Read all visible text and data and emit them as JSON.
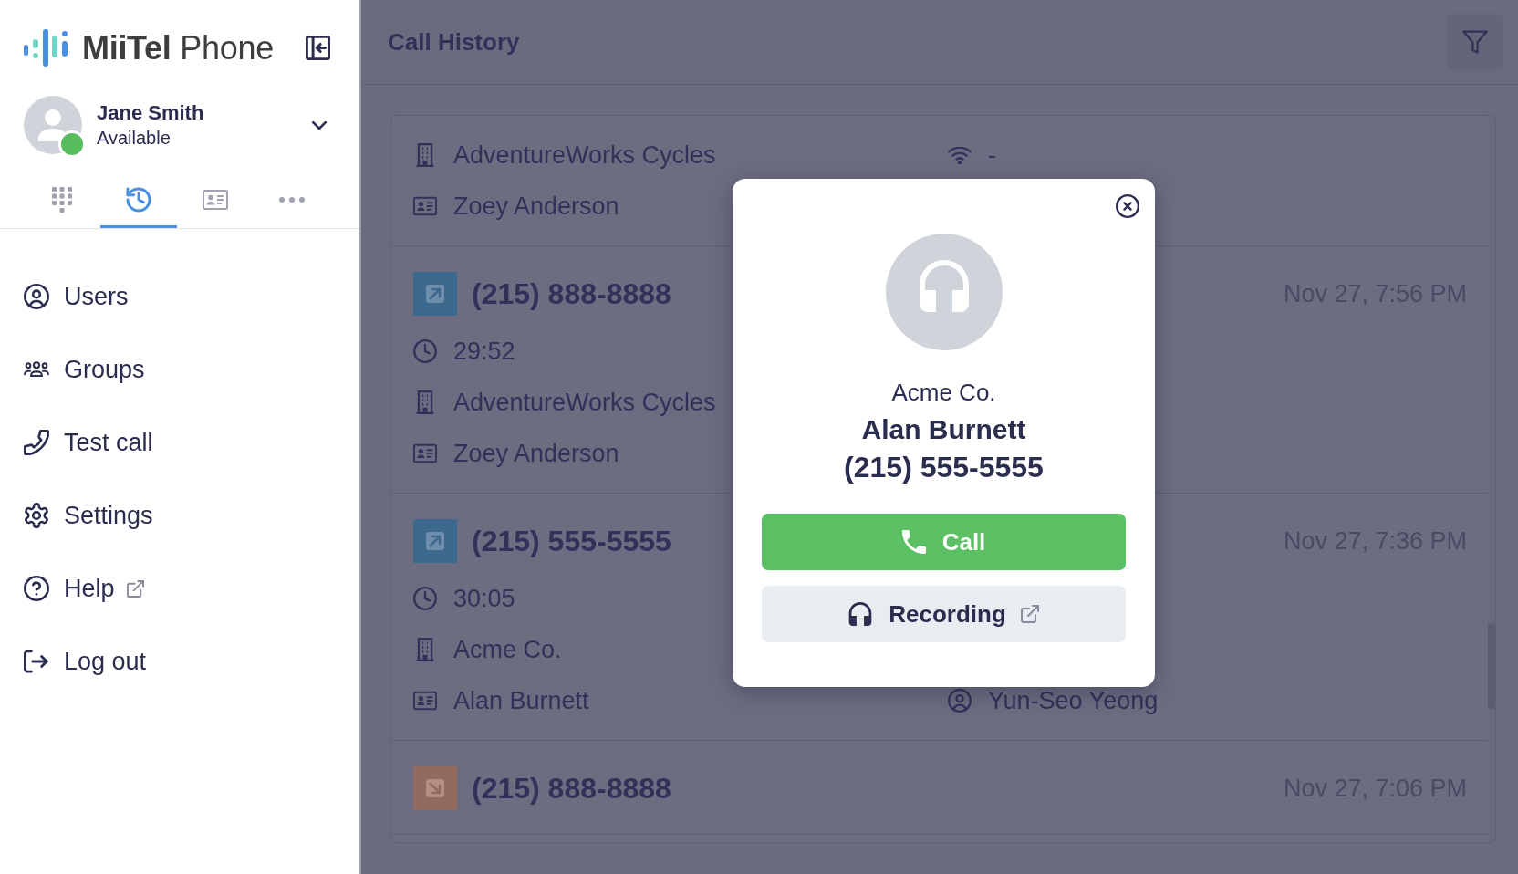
{
  "sidebar": {
    "logo": "**MiiTel** Phone",
    "user": {
      "name": "Jane Smith",
      "status": "Available",
      "online": true
    },
    "tabs": [
      {
        "kind": "dialpad",
        "selected": false
      },
      {
        "kind": "history",
        "selected": true
      },
      {
        "kind": "contacts",
        "selected": false
      },
      {
        "kind": "more",
        "selected": false
      }
    ],
    "menu": [
      {
        "kind": "users",
        "label": "Users",
        "external": false
      },
      {
        "kind": "groups",
        "label": "Groups",
        "external": false
      },
      {
        "kind": "test_call",
        "label": "Test call",
        "external": false
      },
      {
        "kind": "settings",
        "label": "Settings",
        "external": false
      },
      {
        "kind": "help",
        "label": "Help",
        "external": true
      },
      {
        "kind": "logout",
        "label": "Log out",
        "external": false
      }
    ]
  },
  "header": {
    "title": "Call History"
  },
  "calls": [
    {
      "lines": [
        {
          "left": {
            "kind": "company",
            "text": "AdventureWorks Cycles"
          },
          "right": {
            "kind": "network",
            "text": "-"
          }
        },
        {
          "left": {
            "kind": "contact",
            "text": "Zoey Anderson"
          }
        }
      ]
    },
    {
      "kind": "outgoing",
      "number": "(215) 888-8888",
      "time": "Nov 27, 7:56 PM",
      "lines": [
        {
          "left": {
            "kind": "duration",
            "text": "29:52"
          }
        },
        {
          "left": {
            "kind": "company",
            "text": "AdventureWorks Cycles"
          }
        },
        {
          "left": {
            "kind": "contact",
            "text": "Zoey Anderson"
          }
        }
      ]
    },
    {
      "kind": "outgoing",
      "number": "(215) 555-5555",
      "time": "Nov 27, 7:36 PM",
      "lines": [
        {
          "left": {
            "kind": "duration",
            "text": "30:05"
          }
        },
        {
          "left": {
            "kind": "company",
            "text": "Acme Co."
          }
        },
        {
          "left": {
            "kind": "contact",
            "text": "Alan Burnett"
          },
          "right": {
            "kind": "user",
            "text": "Yun-Seo Yeong"
          }
        }
      ]
    },
    {
      "kind": "incoming",
      "number": "(215) 888-8888",
      "time": "Nov 27, 7:06 PM"
    }
  ],
  "dialog": {
    "company": "Acme Co.",
    "name": "Alan Burnett",
    "number": "(215) 555-5555",
    "buttons": [
      {
        "kind": "call",
        "label": "Call",
        "external": false
      },
      {
        "kind": "recording",
        "label": "Recording",
        "external": true
      }
    ]
  }
}
